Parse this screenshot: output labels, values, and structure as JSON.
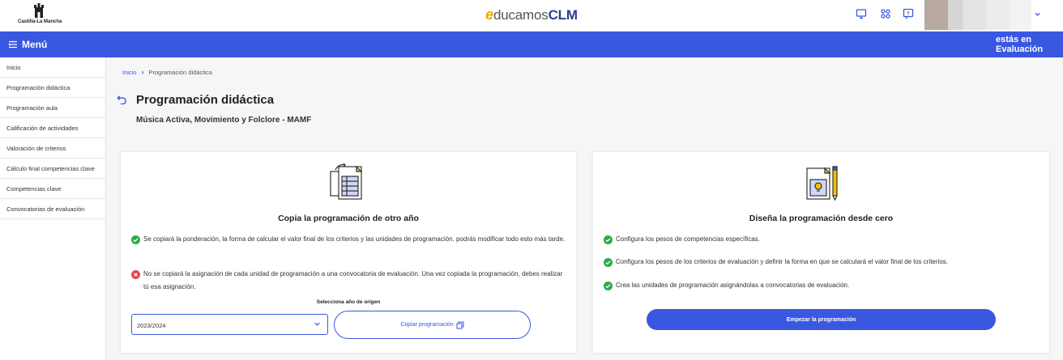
{
  "header": {
    "org_name": "Castilla-La Mancha",
    "brand_e": "e",
    "brand_ducamos": "ducamos",
    "brand_clm": "CLM",
    "icons": [
      "monitor-icon",
      "apps-grid-icon",
      "chat-icon"
    ],
    "user_chevron": "chevron-down-icon"
  },
  "menubar": {
    "menu_label": "Menú",
    "context_line1": "estás en",
    "context_line2": "Evaluación"
  },
  "sidebar": {
    "items": [
      {
        "label": "Inicio"
      },
      {
        "label": "Programación didáctica"
      },
      {
        "label": "Programación aula"
      },
      {
        "label": "Calificación de actividades"
      },
      {
        "label": "Valoración de criterios"
      },
      {
        "label": "Cálculo final competencias clave"
      },
      {
        "label": "Competencias clave"
      },
      {
        "label": "Convocatorias de evaluación"
      }
    ]
  },
  "breadcrumb": {
    "home": "Inicio",
    "current": "Programación didáctica"
  },
  "page": {
    "title": "Programación didáctica",
    "subtitle": "Música Activa, Movimiento y Folclore - MAMF"
  },
  "copy_card": {
    "title": "Copia la programación de otro año",
    "bullet_ok": "Se copiará la ponderación, la forma de calcular el valor final de los criterios y las unidades de programación. podrás modificar todo esto más tarde.",
    "bullet_no": "No se copiará la asignación de cada unidad de programación a una convocatoria de evaluación. Una vez copiada la programación, debes realizar tú esa asignación.",
    "select_label": "Selecciona año de origen",
    "select_value": "2023/2024",
    "button_label": "Copiar programación"
  },
  "design_card": {
    "title": "Diseña la programación desde cero",
    "bullets": [
      "Configura los pesos de competencias específicas.",
      "Configura los pesos de los criterios de evaluación y definir la forma en que se calculará el valor final de los criterios.",
      "Crea las unidades de programación asignándolas a convocatorias de evaluación."
    ],
    "button_label": "Empezar la programación"
  },
  "colors": {
    "primary": "#3a57e0",
    "success": "#2eaa4a",
    "error": "#e04848",
    "accent": "#f0a400"
  }
}
